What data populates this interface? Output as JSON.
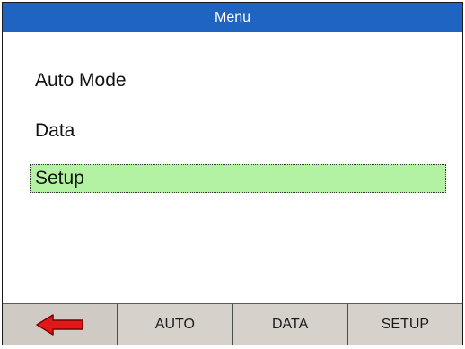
{
  "title": "Menu",
  "menu": {
    "items": [
      {
        "label": "Auto Mode"
      },
      {
        "label": "Data"
      },
      {
        "label": "Setup"
      }
    ]
  },
  "softkeys": {
    "back_icon": "left-arrow-icon",
    "auto": "AUTO",
    "data": "DATA",
    "setup": "SETUP"
  },
  "colors": {
    "title_bar": "#1f64c0",
    "selected_item": "#b3f2a2",
    "arrow": "#e01818"
  }
}
